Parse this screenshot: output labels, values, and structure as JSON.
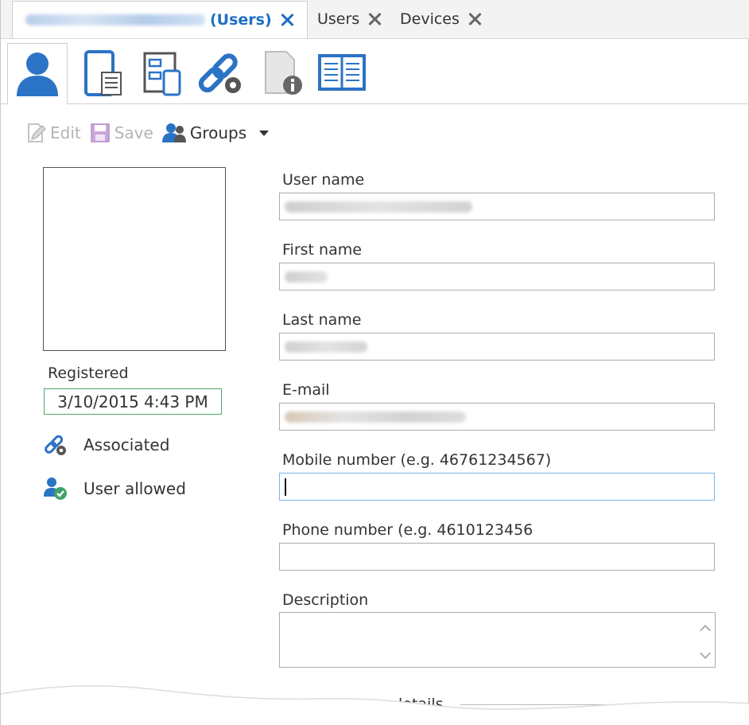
{
  "doc_tabs": [
    {
      "label_suffix": "(Users)",
      "active": true
    },
    {
      "label": "Users",
      "active": false
    },
    {
      "label": "Devices",
      "active": false
    }
  ],
  "icon_tabs": [
    {
      "icon": "user-icon",
      "active": true
    },
    {
      "icon": "device-list-icon"
    },
    {
      "icon": "devices-icon"
    },
    {
      "icon": "link-settings-icon"
    },
    {
      "icon": "document-info-icon"
    },
    {
      "icon": "book-icon"
    }
  ],
  "toolbar": {
    "edit_label": "Edit",
    "save_label": "Save",
    "groups_label": "Groups"
  },
  "registered": {
    "label": "Registered",
    "value": "3/10/2015 4:43 PM"
  },
  "status": {
    "associated_label": "Associated",
    "allowed_label": "User allowed"
  },
  "form": {
    "username_label": "User name",
    "firstname_label": "First name",
    "lastname_label": "Last name",
    "email_label": "E-mail",
    "mobile_label": "Mobile number (e.g. 46761234567)",
    "phone_label": "Phone number (e.g. 4610123456",
    "description_label": "Description",
    "details_label": "letails"
  },
  "colors": {
    "accent": "#1f6fc5",
    "registered_border": "#4ba86a",
    "disabled_text": "#b4b4b4"
  }
}
